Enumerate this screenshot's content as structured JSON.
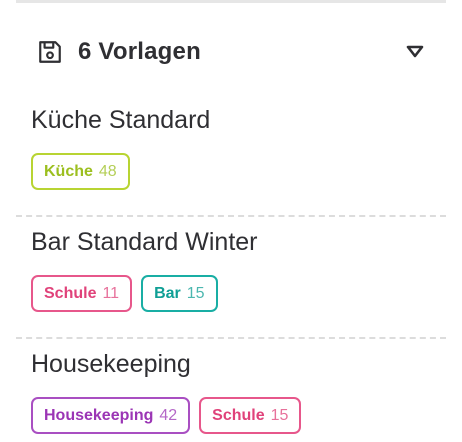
{
  "header": {
    "icon": "save-icon",
    "title": "6 Vorlagen",
    "toggle_icon": "triangle-down-icon"
  },
  "colors": {
    "lime": "#b8d432",
    "pink": "#e7578b",
    "teal": "#19aea4",
    "purple": "#a94fc2"
  },
  "templates": [
    {
      "name": "Küche Standard",
      "tags": [
        {
          "label": "Küche",
          "count": "48",
          "color": "lime"
        }
      ]
    },
    {
      "name": "Bar Standard Winter",
      "tags": [
        {
          "label": "Schule",
          "count": "11",
          "color": "pink"
        },
        {
          "label": "Bar",
          "count": "15",
          "color": "teal"
        }
      ]
    },
    {
      "name": "Housekeeping",
      "tags": [
        {
          "label": "Housekeeping",
          "count": "42",
          "color": "purple"
        },
        {
          "label": "Schule",
          "count": "15",
          "color": "pink"
        }
      ]
    }
  ]
}
